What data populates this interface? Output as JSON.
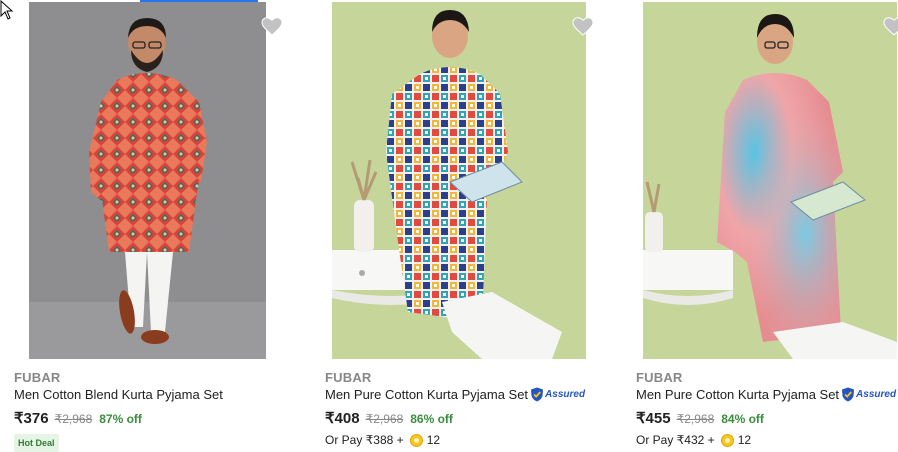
{
  "products": [
    {
      "brand": "FUBAR",
      "title": "Men Cotton Blend Kurta Pyjama Set",
      "price": "₹376",
      "mrp": "₹2,968",
      "discount": "87% off",
      "badge": "Hot Deal",
      "assured": false,
      "image_icon": "kurta-product-image-orange-diamond",
      "wishlist_icon": "heart-icon"
    },
    {
      "brand": "FUBAR",
      "title": "Men Pure Cotton Kurta Pyjama Set",
      "price": "₹408",
      "mrp": "₹2,968",
      "discount": "86% off",
      "assured": true,
      "assured_label": "Assured",
      "or_pay": "Or Pay ₹388 +",
      "coins": "12",
      "image_icon": "kurta-product-image-multicolor-block",
      "wishlist_icon": "heart-icon"
    },
    {
      "brand": "FUBAR",
      "title": "Men Pure Cotton Kurta Pyjama Set",
      "price": "₹455",
      "mrp": "₹2,968",
      "discount": "84% off",
      "assured": true,
      "assured_label": "Assured",
      "or_pay": "Or Pay ₹432 +",
      "coins": "12",
      "image_icon": "kurta-product-image-tie-dye",
      "wishlist_icon": "heart-icon"
    }
  ],
  "colors": {
    "accent": "#2874f0",
    "discount": "#388e3c",
    "muted": "#878787",
    "assured": "#2455c3"
  }
}
